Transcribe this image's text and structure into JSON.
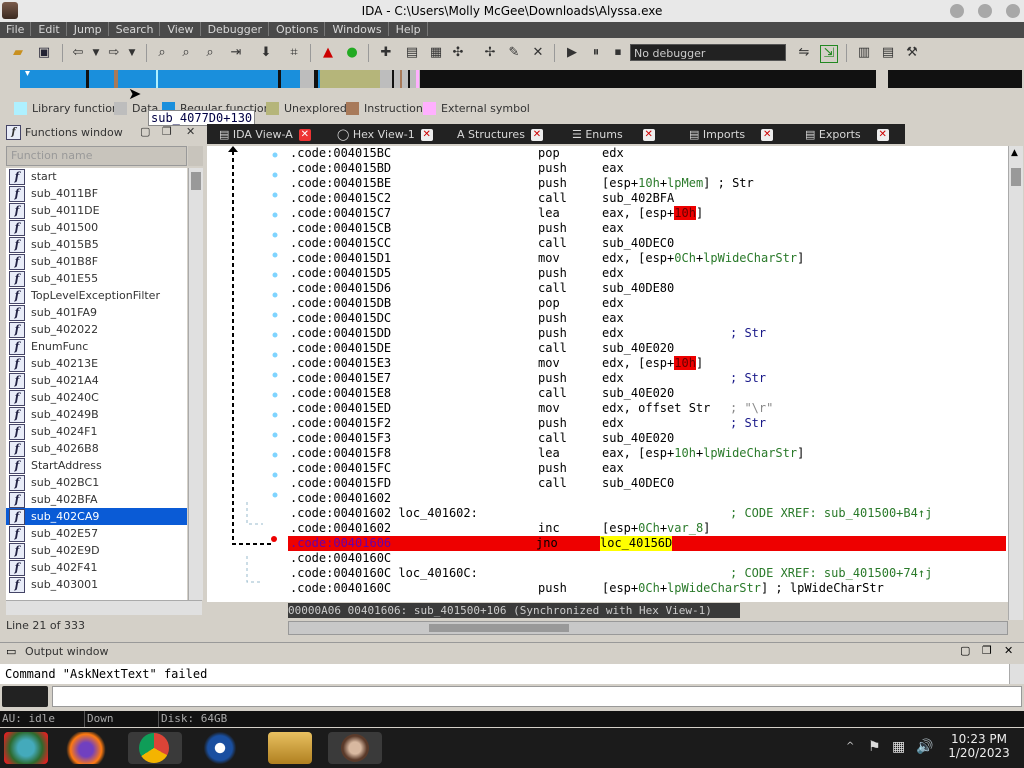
{
  "window": {
    "title": "IDA - C:\\Users\\Molly McGee\\Downloads\\Alyssa.exe"
  },
  "menu": [
    "File",
    "Edit",
    "Jump",
    "Search",
    "View",
    "Debugger",
    "Options",
    "Windows",
    "Help"
  ],
  "toolbar": {
    "debugger_select": "No debugger"
  },
  "legend": [
    {
      "label": "Library function",
      "color": "#aef0ff"
    },
    {
      "label": "Data",
      "color": "#bdbdbd"
    },
    {
      "label": "Regular function",
      "color": "#1a8fdc"
    },
    {
      "label": "Unexplored",
      "color": "#b5b57a"
    },
    {
      "label": "Instruction",
      "color": "#a87a5a"
    },
    {
      "label": "External symbol",
      "color": "#ffb0ff"
    }
  ],
  "functions_panel": {
    "title": "Functions window",
    "column_header": "Function name",
    "status": "Line 21 of 333",
    "items": [
      "start",
      "sub_4011BF",
      "sub_4011DE",
      "sub_401500",
      "sub_4015B5",
      "sub_401B8F",
      "sub_401E55",
      "TopLevelExceptionFilter",
      "sub_401FA9",
      "sub_402022",
      "EnumFunc",
      "sub_40213E",
      "sub_4021A4",
      "sub_40240C",
      "sub_40249B",
      "sub_4024F1",
      "sub_4026B8",
      "StartAddress",
      "sub_402BC1",
      "sub_402BFA",
      "sub_402CA9",
      "sub_402E57",
      "sub_402E9D",
      "sub_402F41",
      "sub_403001"
    ],
    "selected_index": 20
  },
  "tooltip": "sub_4077D0+130",
  "tabs": [
    {
      "label": "IDA View-A",
      "active": true
    },
    {
      "label": "Hex View-1",
      "active": false
    },
    {
      "label": "Structures",
      "active": false
    },
    {
      "label": "Enums",
      "active": false
    },
    {
      "label": "Imports",
      "active": false
    },
    {
      "label": "Exports",
      "active": false
    }
  ],
  "code_lines": [
    {
      "addr": ".code:004015BC",
      "mn": "pop",
      "op": "edx"
    },
    {
      "addr": ".code:004015BD",
      "mn": "push",
      "op": "eax"
    },
    {
      "addr": ".code:004015BE",
      "mn": "push",
      "op": "[esp+10h+lpMem] ; Str"
    },
    {
      "addr": ".code:004015C2",
      "mn": "call",
      "op": "sub_402BFA"
    },
    {
      "addr": ".code:004015C7",
      "mn": "lea",
      "op": "eax, [esp+10h]"
    },
    {
      "addr": ".code:004015CB",
      "mn": "push",
      "op": "eax"
    },
    {
      "addr": ".code:004015CC",
      "mn": "call",
      "op": "sub_40DEC0"
    },
    {
      "addr": ".code:004015D1",
      "mn": "mov",
      "op": "edx, [esp+0Ch+lpWideCharStr]"
    },
    {
      "addr": ".code:004015D5",
      "mn": "push",
      "op": "edx"
    },
    {
      "addr": ".code:004015D6",
      "mn": "call",
      "op": "sub_40DE80"
    },
    {
      "addr": ".code:004015DB",
      "mn": "pop",
      "op": "edx"
    },
    {
      "addr": ".code:004015DC",
      "mn": "push",
      "op": "eax"
    },
    {
      "addr": ".code:004015DD",
      "mn": "push",
      "op": "edx",
      "cm": "; Str"
    },
    {
      "addr": ".code:004015DE",
      "mn": "call",
      "op": "sub_40E020"
    },
    {
      "addr": ".code:004015E3",
      "mn": "mov",
      "op": "edx, [esp+10h]"
    },
    {
      "addr": ".code:004015E7",
      "mn": "push",
      "op": "edx",
      "cm": "; Str"
    },
    {
      "addr": ".code:004015E8",
      "mn": "call",
      "op": "sub_40E020"
    },
    {
      "addr": ".code:004015ED",
      "mn": "mov",
      "op": "edx, offset Str",
      "cmr": "; \"\\r\""
    },
    {
      "addr": ".code:004015F2",
      "mn": "push",
      "op": "edx",
      "cm": "; Str"
    },
    {
      "addr": ".code:004015F3",
      "mn": "call",
      "op": "sub_40E020"
    },
    {
      "addr": ".code:004015F8",
      "mn": "lea",
      "op": "eax, [esp+10h+lpWideCharStr]"
    },
    {
      "addr": ".code:004015FC",
      "mn": "push",
      "op": "eax"
    },
    {
      "addr": ".code:004015FD",
      "mn": "call",
      "op": "sub_40DEC0"
    },
    {
      "addr": ".code:00401602",
      "mn": "",
      "op": ""
    },
    {
      "addr": ".code:00401602 loc_401602:",
      "mn": "",
      "op": "",
      "cm": "; CODE XREF: sub_401500+B4↑j"
    },
    {
      "addr": ".code:00401602",
      "mn": "inc",
      "op": "[esp+0Ch+var_8]"
    },
    {
      "addr": ".code:00401606",
      "mn": "jno",
      "op": "loc_40156D",
      "current": true
    },
    {
      "addr": ".code:0040160C",
      "mn": "",
      "op": ""
    },
    {
      "addr": ".code:0040160C loc_40160C:",
      "mn": "",
      "op": "",
      "cm": "; CODE XREF: sub_401500+74↑j"
    },
    {
      "addr": ".code:0040160C",
      "mn": "push",
      "op": "[esp+0Ch+lpWideCharStr] ; lpWideCharStr"
    }
  ],
  "code_status": "00000A06  00401606: sub_401500+106 (Synchronized with Hex View-1)",
  "output": {
    "title": "Output window",
    "text": "Command \"AskNextText\" failed"
  },
  "bottom_status": {
    "au": "AU:  idle",
    "dir": "Down",
    "disk": "Disk: 64GB"
  },
  "taskbar": {
    "time": "10:23 PM",
    "date": "1/20/2023"
  }
}
